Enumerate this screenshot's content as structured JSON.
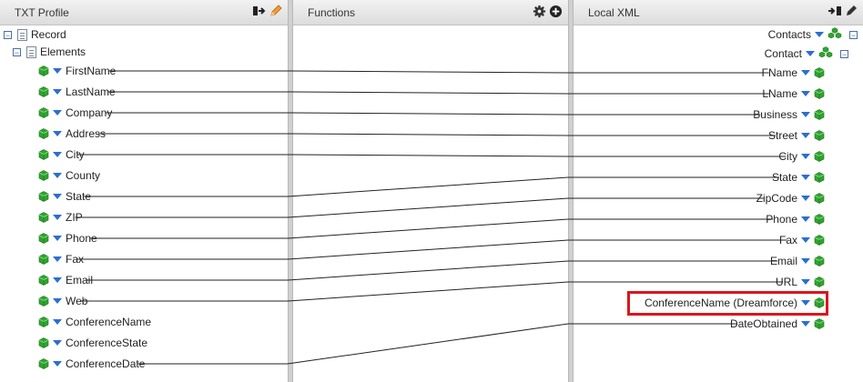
{
  "left_panel": {
    "title": "TXT Profile",
    "icons": [
      "export-icon",
      "pencil-icon"
    ],
    "root": "Record",
    "group": "Elements",
    "fields": [
      "FirstName",
      "LastName",
      "Company",
      "Address",
      "City",
      "County",
      "State",
      "ZIP",
      "Phone",
      "Fax",
      "Email",
      "Web",
      "ConferenceName",
      "ConferenceState",
      "ConferenceDate"
    ]
  },
  "middle_panel": {
    "title": "Functions",
    "icons": [
      "gear-icon",
      "add-icon"
    ]
  },
  "right_panel": {
    "title": "Local XML",
    "icons": [
      "import-icon",
      "pencil-icon"
    ],
    "root": "Contacts",
    "group": "Contact",
    "fields": [
      "FName",
      "LName",
      "Business",
      "Street",
      "City",
      "State",
      "ZipCode",
      "Phone",
      "Fax",
      "Email",
      "URL",
      "ConferenceName (Dreamforce)",
      "DateObtained"
    ],
    "highlighted_field": "ConferenceName (Dreamforce)"
  },
  "mappings": [
    [
      "FirstName",
      "FName"
    ],
    [
      "LastName",
      "LName"
    ],
    [
      "Company",
      "Business"
    ],
    [
      "Address",
      "Street"
    ],
    [
      "City",
      "City"
    ],
    [
      "State",
      "State"
    ],
    [
      "ZIP",
      "ZipCode"
    ],
    [
      "Phone",
      "Phone"
    ],
    [
      "Fax",
      "Fax"
    ],
    [
      "Email",
      "Email"
    ],
    [
      "Web",
      "URL"
    ],
    [
      "ConferenceDate",
      "DateObtained"
    ]
  ],
  "colors": {
    "line": "#222222",
    "highlight": "#d9161c",
    "arrow": "#2a6fd0",
    "cube": "#2fa52f"
  }
}
